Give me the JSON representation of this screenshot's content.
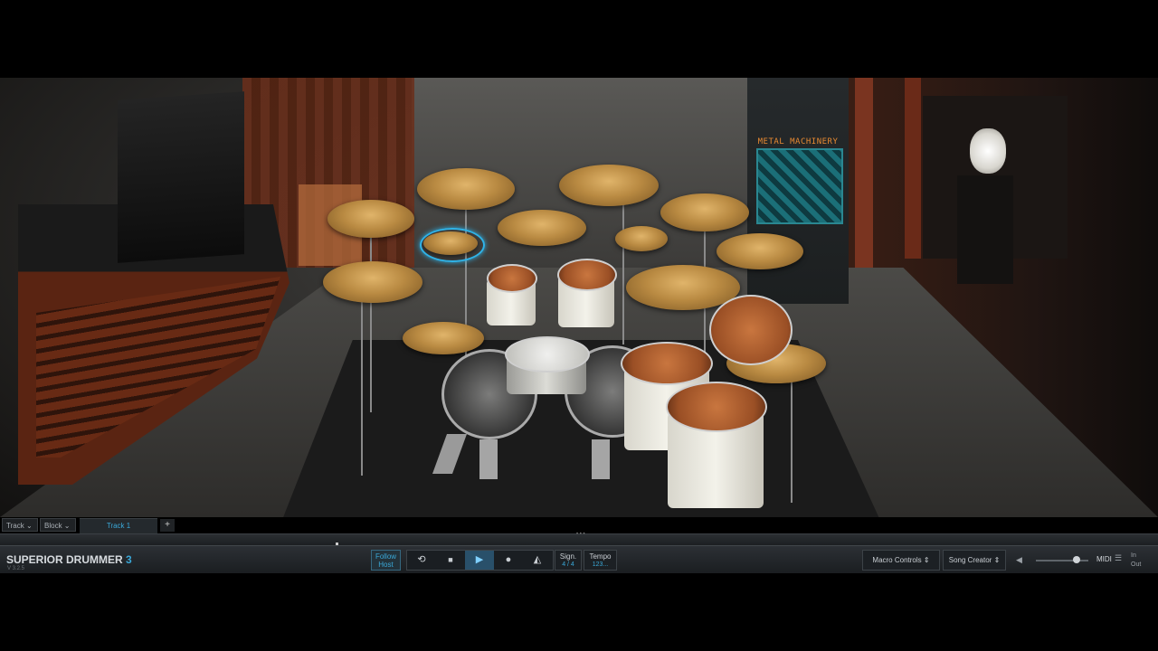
{
  "banner": {
    "title": "METAL MACHINERY"
  },
  "tracks": {
    "track_menu": "Track",
    "block_menu": "Block",
    "active_tab": "Track 1",
    "add_label": "+"
  },
  "transport": {
    "brand_name": "SUPERIOR DRUMMER",
    "brand_number": "3",
    "version": "V 3.2.5",
    "follow_label_1": "Follow",
    "follow_label_2": "Host",
    "loop_icon": "⟲",
    "stop_icon": "■",
    "play_icon": "▶",
    "record_icon": "●",
    "metronome_icon": "◭",
    "sign_label": "Sign.",
    "sign_value": "4 / 4",
    "tempo_label": "Tempo",
    "tempo_value": "123...",
    "macro_controls": "Macro Controls",
    "song_creator": "Song Creator",
    "volume_icon": "◀",
    "volume_level": 0.78,
    "midi_label": "MIDI",
    "midi_icon": "☰",
    "in_label": "In",
    "out_label": "Out"
  },
  "colors": {
    "accent": "#3aa8d8",
    "selection": "#2fb3e8"
  }
}
